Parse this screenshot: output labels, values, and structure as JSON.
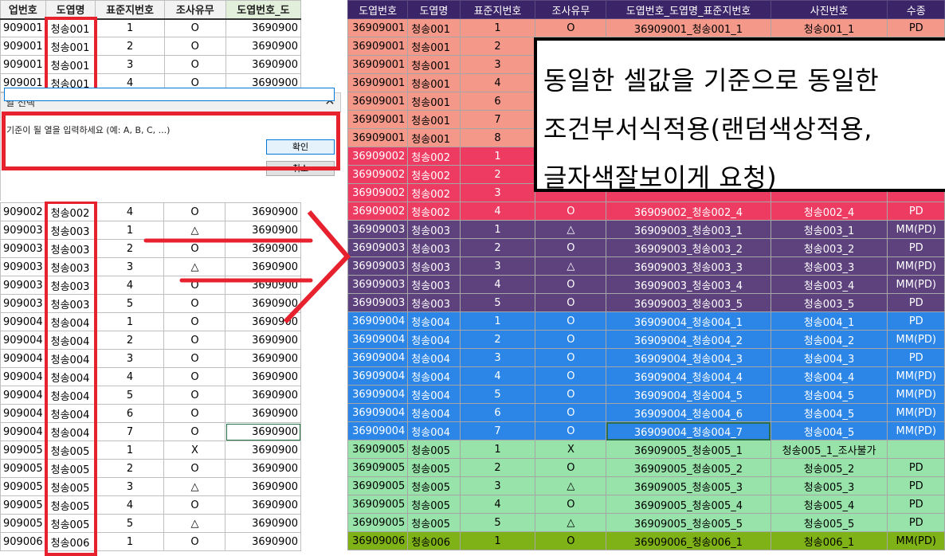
{
  "left_sheet": {
    "headers": [
      "업번호",
      "도엽명",
      "표준지번호",
      "조사유무",
      "도엽번호_도"
    ],
    "rows_top": [
      [
        "909001",
        "청송001",
        "1",
        "O",
        "3690900"
      ],
      [
        "909001",
        "청송001",
        "2",
        "O",
        "3690900"
      ],
      [
        "909001",
        "청송001",
        "3",
        "O",
        "3690900"
      ],
      [
        "909001",
        "청송001",
        "4",
        "O",
        "3690900"
      ]
    ],
    "rows_bottom": [
      [
        "909002",
        "청송002",
        "4",
        "O",
        "3690900"
      ],
      [
        "909003",
        "청송003",
        "1",
        "△",
        "3690900"
      ],
      [
        "909003",
        "청송003",
        "2",
        "O",
        "3690900"
      ],
      [
        "909003",
        "청송003",
        "3",
        "△",
        "3690900"
      ],
      [
        "909003",
        "청송003",
        "4",
        "O",
        "3690900"
      ],
      [
        "909003",
        "청송003",
        "5",
        "O",
        "3690900"
      ],
      [
        "909004",
        "청송004",
        "1",
        "O",
        "3690900"
      ],
      [
        "909004",
        "청송004",
        "2",
        "O",
        "3690900"
      ],
      [
        "909004",
        "청송004",
        "3",
        "O",
        "3690900"
      ],
      [
        "909004",
        "청송004",
        "4",
        "O",
        "3690900"
      ],
      [
        "909004",
        "청송004",
        "5",
        "O",
        "3690900"
      ],
      [
        "909004",
        "청송004",
        "6",
        "O",
        "3690900"
      ],
      [
        "909004",
        "청송004",
        "7",
        "O",
        "3690900"
      ],
      [
        "909005",
        "청송005",
        "1",
        "X",
        "3690900"
      ],
      [
        "909005",
        "청송005",
        "2",
        "O",
        "3690900"
      ],
      [
        "909005",
        "청송005",
        "3",
        "△",
        "3690900"
      ],
      [
        "909005",
        "청송005",
        "4",
        "O",
        "3690900"
      ],
      [
        "909005",
        "청송005",
        "5",
        "△",
        "3690900"
      ],
      [
        "909006",
        "청송006",
        "1",
        "O",
        "3690900"
      ]
    ]
  },
  "dialog": {
    "title": "열 선택",
    "close_glyph": "✕",
    "prompt": "기준이 될 열을 입력하세요 (예: A, B, C, ...)",
    "ok_label": "확인",
    "cancel_label": "취소",
    "input_value": ""
  },
  "right_sheet": {
    "headers": [
      "도엽번호",
      "도엽명",
      "표준지번호",
      "조사유무",
      "도엽번호_도엽명_표준지번호",
      "사진번호",
      "수종"
    ],
    "rows": [
      [
        "36909001",
        "청송001",
        "1",
        "O",
        "36909001_청송001_1",
        "청송001_1",
        "PD",
        "#f4998a",
        "#000000"
      ],
      [
        "36909001",
        "청송001",
        "2",
        "",
        "",
        "",
        "",
        "#f4998a",
        "#000000"
      ],
      [
        "36909001",
        "청송001",
        "3",
        "",
        "",
        "",
        "",
        "#f4998a",
        "#000000"
      ],
      [
        "36909001",
        "청송001",
        "4",
        "",
        "",
        "",
        "",
        "#f4998a",
        "#000000"
      ],
      [
        "36909001",
        "청송001",
        "6",
        "",
        "",
        "",
        "",
        "#f4998a",
        "#000000"
      ],
      [
        "36909001",
        "청송001",
        "7",
        "",
        "",
        "",
        "",
        "#f4998a",
        "#000000"
      ],
      [
        "36909001",
        "청송001",
        "8",
        "",
        "",
        "",
        "",
        "#f4998a",
        "#000000"
      ],
      [
        "36909002",
        "청송002",
        "1",
        "",
        "",
        "",
        "",
        "#ee3b62",
        "#ffffff"
      ],
      [
        "36909002",
        "청송002",
        "2",
        "",
        "",
        "",
        "",
        "#ee3b62",
        "#ffffff"
      ],
      [
        "36909002",
        "청송002",
        "3",
        "",
        "",
        "",
        "",
        "#ee3b62",
        "#ffffff"
      ],
      [
        "36909002",
        "청송002",
        "4",
        "O",
        "36909002_청송002_4",
        "청송002_4",
        "PD",
        "#ee3b62",
        "#ffffff"
      ],
      [
        "36909003",
        "청송003",
        "1",
        "△",
        "36909003_청송003_1",
        "청송003_1",
        "MM(PD)",
        "#5e427e",
        "#ffffff"
      ],
      [
        "36909003",
        "청송003",
        "2",
        "O",
        "36909003_청송003_2",
        "청송003_2",
        "PD",
        "#5e427e",
        "#ffffff"
      ],
      [
        "36909003",
        "청송003",
        "3",
        "△",
        "36909003_청송003_3",
        "청송003_3",
        "MM(PD)",
        "#5e427e",
        "#ffffff"
      ],
      [
        "36909003",
        "청송003",
        "4",
        "O",
        "36909003_청송003_4",
        "청송003_4",
        "MM(PD)",
        "#5e427e",
        "#ffffff"
      ],
      [
        "36909003",
        "청송003",
        "5",
        "O",
        "36909003_청송003_5",
        "청송003_5",
        "PD",
        "#5e427e",
        "#ffffff"
      ],
      [
        "36909004",
        "청송004",
        "1",
        "O",
        "36909004_청송004_1",
        "청송004_1",
        "PD",
        "#2b86e8",
        "#ffffff"
      ],
      [
        "36909004",
        "청송004",
        "2",
        "O",
        "36909004_청송004_2",
        "청송004_2",
        "MM(PD)",
        "#2b86e8",
        "#ffffff"
      ],
      [
        "36909004",
        "청송004",
        "3",
        "O",
        "36909004_청송004_3",
        "청송004_3",
        "PD",
        "#2b86e8",
        "#ffffff"
      ],
      [
        "36909004",
        "청송004",
        "4",
        "O",
        "36909004_청송004_4",
        "청송004_4",
        "MM(PD)",
        "#2b86e8",
        "#ffffff"
      ],
      [
        "36909004",
        "청송004",
        "5",
        "O",
        "36909004_청송004_5",
        "청송004_5",
        "MM(PD)",
        "#2b86e8",
        "#ffffff"
      ],
      [
        "36909004",
        "청송004",
        "6",
        "O",
        "36909004_청송004_6",
        "청송004_5",
        "MM(PD)",
        "#2b86e8",
        "#ffffff"
      ],
      [
        "36909004",
        "청송004",
        "7",
        "O",
        "36909004_청송004_7",
        "청송004_5",
        "MM(PD)",
        "#2b86e8",
        "#ffffff"
      ],
      [
        "36909005",
        "청송005",
        "1",
        "X",
        "36909005_청송005_1",
        "청송005_1_조사불가",
        "",
        "#97e3a9",
        "#000000"
      ],
      [
        "36909005",
        "청송005",
        "2",
        "O",
        "36909005_청송005_2",
        "청송005_2",
        "PD",
        "#97e3a9",
        "#000000"
      ],
      [
        "36909005",
        "청송005",
        "3",
        "△",
        "36909005_청송005_3",
        "청송005_3",
        "PD",
        "#97e3a9",
        "#000000"
      ],
      [
        "36909005",
        "청송005",
        "4",
        "O",
        "36909005_청송005_4",
        "청송005_4",
        "PD",
        "#97e3a9",
        "#000000"
      ],
      [
        "36909005",
        "청송005",
        "5",
        "△",
        "36909005_청송005_5",
        "청송005_5",
        "PD",
        "#97e3a9",
        "#000000"
      ],
      [
        "36909006",
        "청송006",
        "1",
        "O",
        "36909006_청송006_1",
        "청송006_1",
        "MM(PD)",
        "#7fb216",
        "#000000"
      ]
    ]
  },
  "callout": {
    "line1": "동일한 셀값을 기준으로 동일한",
    "line2": "조건부서식적용(랜덤색상적용,",
    "line3": "글자색잘보이게 요청)"
  },
  "colors": {
    "annotation_red": "#e8212f",
    "header_purple": "#3b2468"
  }
}
